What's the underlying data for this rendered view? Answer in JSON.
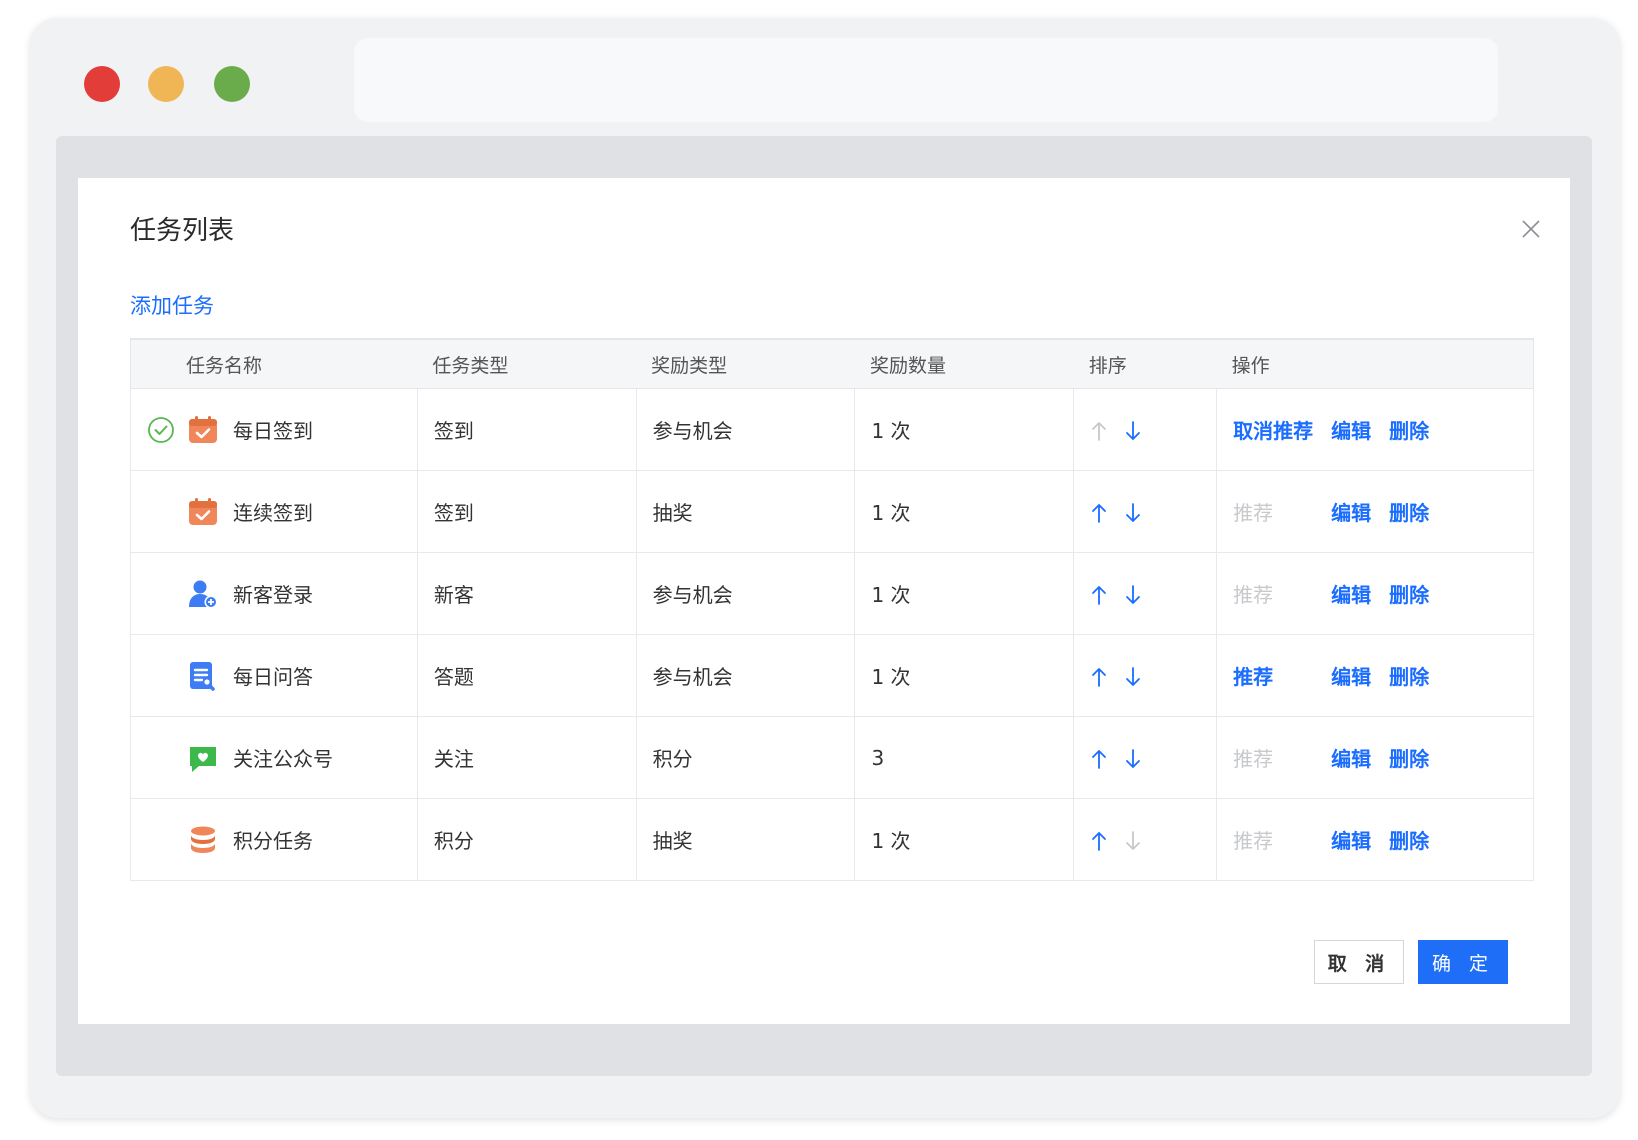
{
  "dialog": {
    "title": "任务列表",
    "add_task": "添加任务",
    "cancel": "取 消",
    "confirm": "确 定"
  },
  "table": {
    "headers": [
      "任务名称",
      "任务类型",
      "奖励类型",
      "奖励数量",
      "排序",
      "操作"
    ],
    "rows": [
      {
        "name": "每日签到",
        "type": "签到",
        "reward_type": "参与机会",
        "reward_amount": "1 次",
        "icon": "calendar-check-icon",
        "selected": true,
        "up_enabled": false,
        "down_enabled": true,
        "recommend": "取消推荐",
        "recommend_enabled": true,
        "edit": "编辑",
        "delete": "删除"
      },
      {
        "name": "连续签到",
        "type": "签到",
        "reward_type": "抽奖",
        "reward_amount": "1 次",
        "icon": "calendar-check-icon",
        "selected": false,
        "up_enabled": true,
        "down_enabled": true,
        "recommend": "推荐",
        "recommend_enabled": false,
        "edit": "编辑",
        "delete": "删除"
      },
      {
        "name": "新客登录",
        "type": "新客",
        "reward_type": "参与机会",
        "reward_amount": "1 次",
        "icon": "user-add-icon",
        "selected": false,
        "up_enabled": true,
        "down_enabled": true,
        "recommend": "推荐",
        "recommend_enabled": false,
        "edit": "编辑",
        "delete": "删除"
      },
      {
        "name": "每日问答",
        "type": "答题",
        "reward_type": "参与机会",
        "reward_amount": "1 次",
        "icon": "quiz-doc-icon",
        "selected": false,
        "up_enabled": true,
        "down_enabled": true,
        "recommend": "推荐",
        "recommend_enabled": true,
        "edit": "编辑",
        "delete": "删除"
      },
      {
        "name": "关注公众号",
        "type": "关注",
        "reward_type": "积分",
        "reward_amount": "3",
        "icon": "chat-heart-icon",
        "selected": false,
        "up_enabled": true,
        "down_enabled": true,
        "recommend": "推荐",
        "recommend_enabled": false,
        "edit": "编辑",
        "delete": "删除"
      },
      {
        "name": "积分任务",
        "type": "积分",
        "reward_type": "抽奖",
        "reward_amount": "1 次",
        "icon": "coin-stack-icon",
        "selected": false,
        "up_enabled": true,
        "down_enabled": false,
        "recommend": "推荐",
        "recommend_enabled": false,
        "edit": "编辑",
        "delete": "删除"
      }
    ]
  },
  "colors": {
    "primary": "#1a6dff",
    "disabled": "#c7c9cc",
    "icon_orange": "#f0875a",
    "icon_blue": "#3d7cf5",
    "icon_green": "#3cb94a",
    "check_green": "#5ab552"
  }
}
